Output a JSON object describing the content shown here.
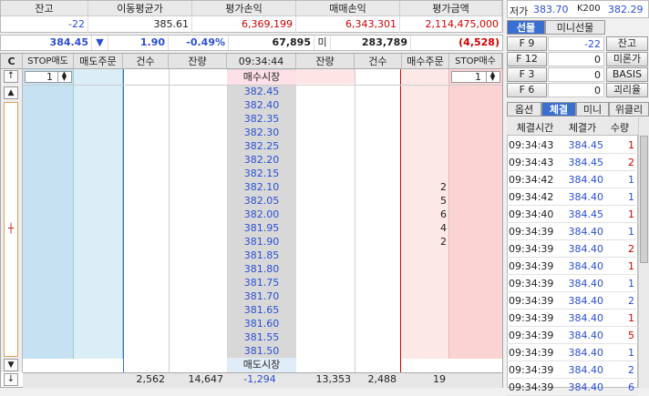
{
  "summary": {
    "headers": [
      "잔고",
      "이동평균가",
      "평가손익",
      "매매손익",
      "평가금액"
    ],
    "values": [
      "-22",
      "385.61",
      "6,369,199",
      "6,343,301",
      "2,114,475,000"
    ]
  },
  "quote": {
    "price": "384.45",
    "arrow": "▼",
    "change": "1.90",
    "rate": "-0.49%",
    "volume": "67,895",
    "mi_label": "미",
    "open_interest": "283,789",
    "oi_change": "(4,528)"
  },
  "top_info": {
    "low_label": "저가",
    "low": "383.70",
    "k200_label": "K200",
    "k200": "382.29"
  },
  "grid": {
    "headers": [
      "C",
      "STOP매도",
      "매도주문",
      "건수",
      "잔량",
      "09:34:44",
      "잔량",
      "건수",
      "매수주문",
      "STOP매수"
    ],
    "stop_sell_qty": "1",
    "stop_buy_qty": "1",
    "market_sell": "매수시장",
    "market_buy": "매도시장",
    "prices": [
      "382.45",
      "382.40",
      "382.35",
      "382.30",
      "382.25",
      "382.20",
      "382.15",
      "382.10",
      "382.05",
      "382.00",
      "381.95",
      "381.90",
      "381.85",
      "381.80",
      "381.75",
      "381.70",
      "381.65",
      "381.60",
      "381.55",
      "381.50"
    ],
    "buy_orders": [
      "",
      "",
      "",
      "",
      "",
      "",
      "",
      "2",
      "5",
      "6",
      "4",
      "2",
      "",
      "",
      "",
      "",
      "",
      "",
      "",
      ""
    ],
    "totals": {
      "sell_count": "2,562",
      "sell_qty": "14,647",
      "net": "-1,294",
      "buy_qty": "13,353",
      "buy_count": "2,488",
      "buy_orders": "19"
    }
  },
  "right": {
    "tabs1": [
      "선물",
      "미니선물"
    ],
    "fkeys": [
      {
        "key": "F 9",
        "val": "-22",
        "btn": "잔고"
      },
      {
        "key": "F 12",
        "val": "0",
        "btn": "미론가"
      },
      {
        "key": "F 3",
        "val": "0",
        "btn": "BASIS"
      },
      {
        "key": "F 6",
        "val": "0",
        "btn": "괴리율"
      }
    ],
    "tabs2": [
      "옵션",
      "체결",
      "미니",
      "위클리"
    ],
    "trade_headers": [
      "체결시간",
      "체결가",
      "수량"
    ],
    "trades": [
      {
        "time": "09:34:43",
        "price": "384.45",
        "qty": "1",
        "dir": "up"
      },
      {
        "time": "09:34:43",
        "price": "384.45",
        "qty": "2",
        "dir": "up"
      },
      {
        "time": "09:34:42",
        "price": "384.40",
        "qty": "1",
        "dir": "down"
      },
      {
        "time": "09:34:42",
        "price": "384.40",
        "qty": "1",
        "dir": "down"
      },
      {
        "time": "09:34:40",
        "price": "384.45",
        "qty": "1",
        "dir": "up"
      },
      {
        "time": "09:34:39",
        "price": "384.40",
        "qty": "1",
        "dir": "down"
      },
      {
        "time": "09:34:39",
        "price": "384.40",
        "qty": "2",
        "dir": "up"
      },
      {
        "time": "09:34:39",
        "price": "384.40",
        "qty": "1",
        "dir": "up"
      },
      {
        "time": "09:34:39",
        "price": "384.40",
        "qty": "1",
        "dir": "down"
      },
      {
        "time": "09:34:39",
        "price": "384.40",
        "qty": "2",
        "dir": "down"
      },
      {
        "time": "09:34:39",
        "price": "384.40",
        "qty": "1",
        "dir": "up"
      },
      {
        "time": "09:34:39",
        "price": "384.40",
        "qty": "5",
        "dir": "up"
      },
      {
        "time": "09:34:39",
        "price": "384.40",
        "qty": "1",
        "dir": "down"
      },
      {
        "time": "09:34:39",
        "price": "384.40",
        "qty": "2",
        "dir": "down"
      },
      {
        "time": "09:34:39",
        "price": "384.40",
        "qty": "6",
        "dir": "down"
      }
    ]
  },
  "colors": {
    "price_blue": "#2b4fd6",
    "red": "#d40000",
    "sell_bg": "#c5e1f2",
    "buy_bg": "#fbd3d3"
  }
}
